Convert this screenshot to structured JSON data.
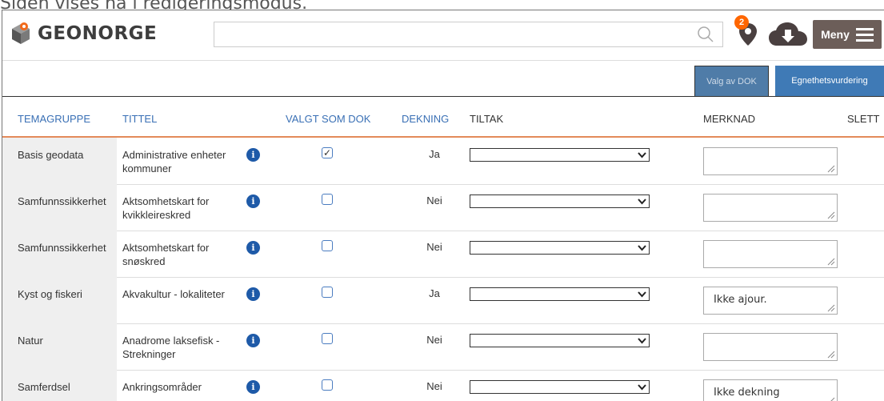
{
  "caption": "Siden vises nå i redigeringsmodus.",
  "header": {
    "logo_text": "GEONORGE",
    "search_value": "",
    "map_badge_count": "2",
    "menu_label": "Meny"
  },
  "tabs": [
    {
      "label": "Valg av DOK",
      "active": true
    },
    {
      "label": "Egnethetsvurdering",
      "active": false
    }
  ],
  "columns": {
    "temagruppe": "TEMAGRUPPE",
    "tittel": "TITTEL",
    "valgt": "VALGT SOM DOK",
    "dekning": "DEKNING",
    "tiltak": "TILTAK",
    "merknad": "MERKNAD",
    "slett": "SLETT"
  },
  "rows": [
    {
      "temagruppe": "Basis geodata",
      "tittel": "Administrative enheter kommuner",
      "valgt": true,
      "dekning": "Ja",
      "tiltak": "",
      "merknad": ""
    },
    {
      "temagruppe": "Samfunnssikkerhet",
      "tittel": "Aktsomhetskart for kvikkleireskred",
      "valgt": false,
      "dekning": "Nei",
      "tiltak": "",
      "merknad": ""
    },
    {
      "temagruppe": "Samfunnssikkerhet",
      "tittel": "Aktsomhetskart for snøskred",
      "valgt": false,
      "dekning": "Nei",
      "tiltak": "",
      "merknad": ""
    },
    {
      "temagruppe": "Kyst og fiskeri",
      "tittel": "Akvakultur - lokaliteter",
      "valgt": false,
      "dekning": "Ja",
      "tiltak": "",
      "merknad": "Ikke ajour."
    },
    {
      "temagruppe": "Natur",
      "tittel": "Anadrome laksefisk - Strekninger",
      "valgt": false,
      "dekning": "Nei",
      "tiltak": "",
      "merknad": ""
    },
    {
      "temagruppe": "Samferdsel",
      "tittel": "Ankringsområder",
      "valgt": false,
      "dekning": "Nei",
      "tiltak": "",
      "merknad": "Ikke dekning"
    }
  ],
  "colors": {
    "accent_blue": "#3a70b5",
    "tab_blue": "#3f7ab6",
    "header_rule": "#e38a5a",
    "badge_orange": "#ff6600",
    "menu_brown": "#6c5e59"
  }
}
